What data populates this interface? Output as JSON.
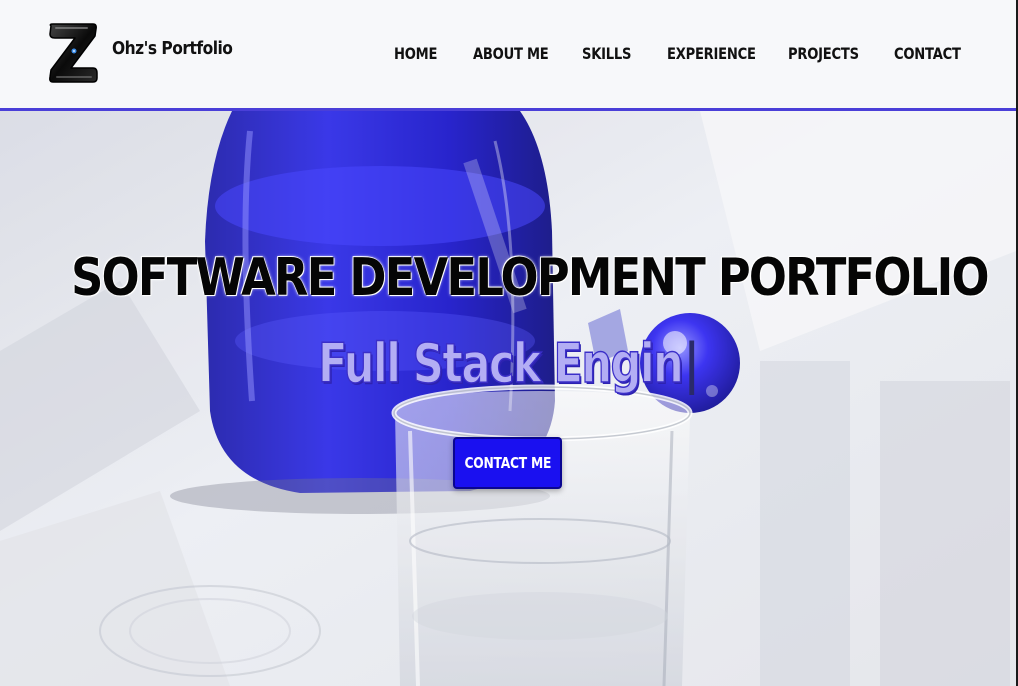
{
  "header": {
    "brand_name": "Ohz's Portfolio",
    "logo_letter": "Z",
    "accent_color": "#4a3fd8",
    "nav": [
      {
        "label": "HOME"
      },
      {
        "label": "ABOUT ME"
      },
      {
        "label": "SKILLS"
      },
      {
        "label": "EXPERIENCE"
      },
      {
        "label": "PROJECTS"
      },
      {
        "label": "CONTACT"
      }
    ]
  },
  "hero": {
    "title": "SOFTWARE DEVELOPMENT PORTFOLIO",
    "typed_text": "Full Stack Engin",
    "cursor": "|",
    "cta_label": "CONTACT ME",
    "cta_color": "#1a10f0",
    "subtitle_color": "#b3aef4"
  }
}
